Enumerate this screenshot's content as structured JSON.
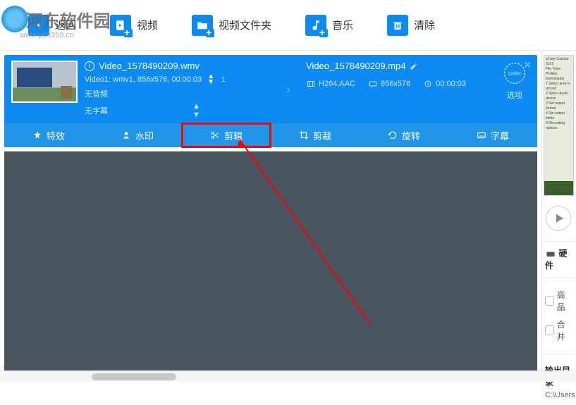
{
  "watermark": {
    "text": "河东软件园",
    "url": "www.pc0359.cn"
  },
  "toolbar": {
    "back": "返回",
    "video": "视频",
    "folder": "视频文件夹",
    "music": "音乐",
    "clear": "清除"
  },
  "video": {
    "src_name": "Video_1578490209.wmv",
    "src_meta": "Video1: wmv1, 856x576, 00:00:03",
    "src_audio": "无音频",
    "src_sub": "无字幕",
    "dst_name": "Video_1578490209.mp4",
    "dst_codec": "H264,AAC",
    "dst_res": "856x576",
    "dst_dur": "00:00:03",
    "options": "选项"
  },
  "tabs": {
    "effects": "特效",
    "watermark": "水印",
    "trim": "剪辑",
    "crop": "剪裁",
    "rotate": "旋转",
    "subtitle": "字幕"
  },
  "right": {
    "hardware": "硬件",
    "hq": "高品",
    "merge": "合并",
    "output_label": "输出目录",
    "output_path": "C:\\Users"
  }
}
